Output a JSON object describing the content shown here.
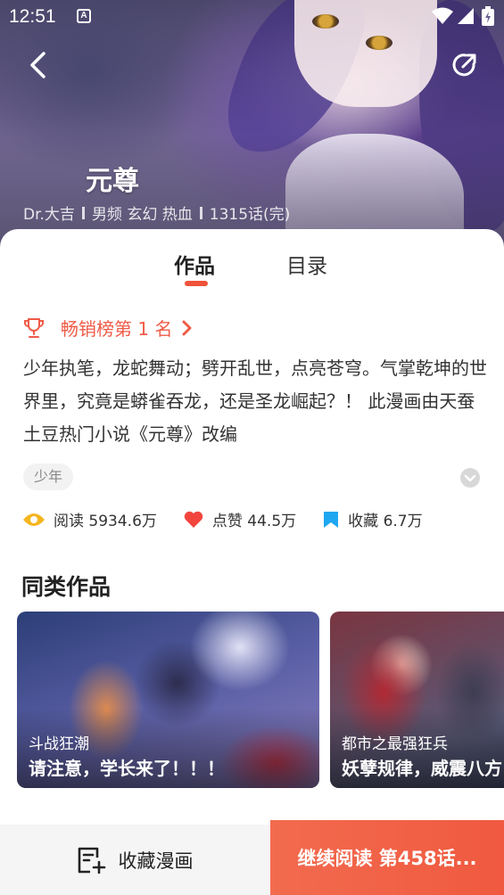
{
  "status_bar": {
    "time": "12:51",
    "badge": "A"
  },
  "comic": {
    "title": "元尊",
    "author": "Dr.大吉",
    "genres": "男频 玄幻 热血",
    "chapters": "1315话(完)"
  },
  "tabs": [
    {
      "label": "作品",
      "active": true
    },
    {
      "label": "目录",
      "active": false
    }
  ],
  "rank": {
    "label": "畅销榜第 1 名"
  },
  "description": "少年执笔，龙蛇舞动；劈开乱世，点亮苍穹。气掌乾坤的世界里，究竟是蟒雀吞龙，还是圣龙崛起？！ 此漫画由天蚕土豆热门小说《元尊》改编",
  "tag": "少年",
  "stats": {
    "reads_label": "阅读",
    "reads_value": "5934.6万",
    "likes_label": "点赞",
    "likes_value": "44.5万",
    "favorites_label": "收藏",
    "favorites_value": "6.7万"
  },
  "similar": {
    "title": "同类作品",
    "items": [
      {
        "subtitle": "斗战狂潮",
        "headline": "请注意，学长来了！！！"
      },
      {
        "subtitle": "都市之最强狂兵",
        "headline": "妖孽规律，威震八方"
      }
    ]
  },
  "bottom_bar": {
    "favorite_label": "收藏漫画",
    "continue_label": "继续阅读 第458话..."
  },
  "colors": {
    "accent": "#f0523a",
    "rank": "#ef5b48",
    "eye_icon": "#f5b51e",
    "heart_icon": "#f2453d",
    "bookmark_icon": "#1ea7f0"
  },
  "icons": [
    "back-arrow-icon",
    "share-icon",
    "trophy-icon",
    "chevron-right-icon",
    "chevron-down-icon",
    "eye-icon",
    "heart-icon",
    "bookmark-icon",
    "add-favorite-icon"
  ]
}
